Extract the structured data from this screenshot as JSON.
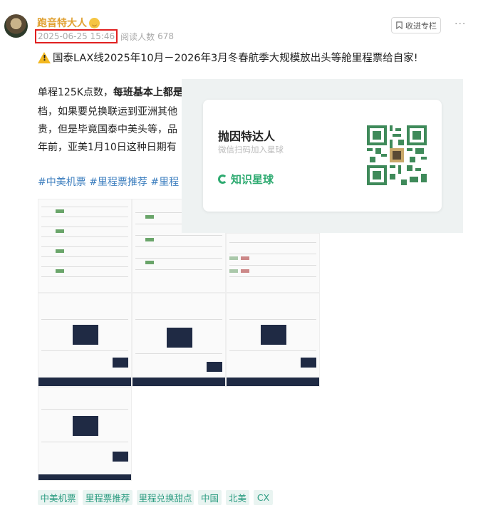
{
  "header": {
    "author": "跑音特大人",
    "date": "2025-06-25 15:46",
    "reads_label": "阅读人数",
    "reads_count": "678",
    "follow_label": "收进专栏",
    "more": "···"
  },
  "post": {
    "title": "国泰LAX线2025年10月－2026年3月冬春航季大规模放出头等舱里程票给自家!",
    "lines": [
      {
        "pre": "单程125K点数，",
        "bold": "每班基本上都是"
      },
      {
        "pre": "档，如果要兑换联运到亚洲其他",
        "bold": ""
      },
      {
        "pre": "贵，但是毕竟国泰中美头等，品",
        "bold": ""
      },
      {
        "pre": "年前，亚美1月10日这种日期有",
        "bold": ""
      }
    ],
    "hashtags": "#中美机票  #里程票推荐  #里程"
  },
  "overlay": {
    "title": "抛因特达人",
    "subtitle": "微信扫码加入星球",
    "brand": "知识星球"
  },
  "thumbs": [
    {
      "price": ""
    },
    {
      "price": ""
    },
    {
      "price": ""
    },
    {
      "price": ""
    },
    {
      "price": ""
    },
    {
      "price": ""
    },
    {
      "price": ""
    }
  ],
  "tags": [
    "中美机票",
    "里程票推荐",
    "里程兑换甜点",
    "中国",
    "北美",
    "CX"
  ],
  "colors": {
    "accent": "#2daa70",
    "author": "#e0a030",
    "highlight_box": "#e02020",
    "hashtag": "#3e7fbf"
  }
}
